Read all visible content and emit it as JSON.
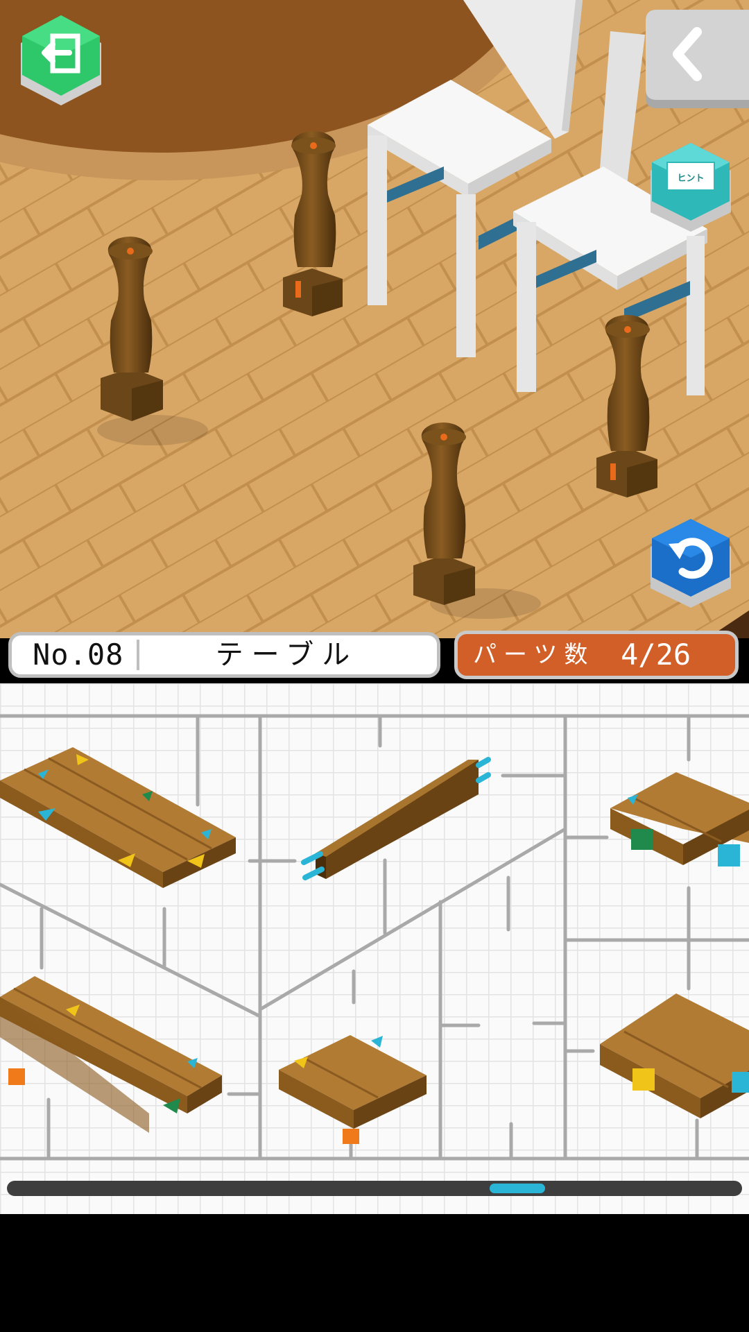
{
  "level": {
    "number": "No.08",
    "title": "テーブル"
  },
  "parts": {
    "label": "パーツ数",
    "count": "4/26",
    "placed": 4,
    "total": 26
  },
  "buttons": {
    "exit_icon": "exit-door-icon",
    "back_icon": "chevron-left-icon",
    "hint_label": "ヒント",
    "undo_icon": "undo-arrow-icon"
  },
  "scroll": {
    "position": 0.71,
    "thumb_fraction": 0.075
  },
  "colors": {
    "floor": "#d9a765",
    "wood": "#a8752f",
    "post": "#6b4619",
    "accent_orange": "#d35f28",
    "accent_green": "#2ec86a",
    "accent_teal": "#3cc6c6",
    "accent_blue": "#1b6fc9"
  }
}
